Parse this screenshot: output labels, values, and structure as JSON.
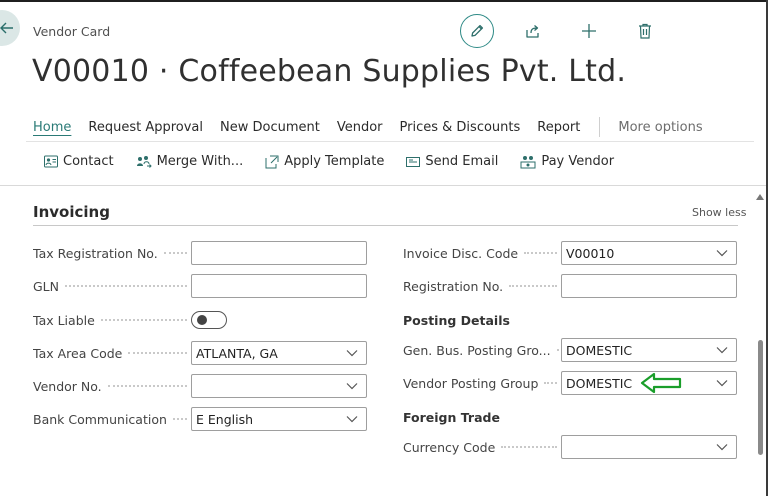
{
  "header": {
    "card_label": "Vendor Card",
    "title": "V00010 · Coffeebean Supplies Pvt. Ltd.",
    "actions": [
      {
        "name": "edit",
        "icon": "pencil-icon"
      },
      {
        "name": "share",
        "icon": "share-icon"
      },
      {
        "name": "new",
        "icon": "plus-icon"
      },
      {
        "name": "delete",
        "icon": "trash-icon"
      }
    ]
  },
  "menu": {
    "items": [
      "Home",
      "Request Approval",
      "New Document",
      "Vendor",
      "Prices & Discounts",
      "Report"
    ],
    "active": "Home",
    "more": "More options"
  },
  "toolbar": {
    "items": [
      "Contact",
      "Merge With...",
      "Apply Template",
      "Send Email",
      "Pay Vendor"
    ]
  },
  "section": {
    "title": "Invoicing",
    "toggle_label": "Show less"
  },
  "left_fields": [
    {
      "label": "Tax Registration No.",
      "value": "",
      "type": "text"
    },
    {
      "label": "GLN",
      "value": "",
      "type": "text"
    },
    {
      "label": "Tax Liable",
      "value": "off",
      "type": "toggle"
    },
    {
      "label": "Tax Area Code",
      "value": "ATLANTA, GA",
      "type": "select"
    },
    {
      "label": "Vendor No.",
      "value": "",
      "type": "select"
    },
    {
      "label": "Bank Communication",
      "value": "E English",
      "type": "select"
    }
  ],
  "right_fields": {
    "invoice_disc_code": {
      "label": "Invoice Disc. Code",
      "value": "V00010",
      "type": "select"
    },
    "registration_no": {
      "label": "Registration No.",
      "value": "",
      "type": "text"
    },
    "posting_details_heading": "Posting Details",
    "gen_bus_posting_group": {
      "label": "Gen. Bus. Posting Gro...",
      "value": "DOMESTIC",
      "type": "select"
    },
    "vendor_posting_group": {
      "label": "Vendor Posting Group",
      "value": "DOMESTIC",
      "type": "select"
    },
    "foreign_trade_heading": "Foreign Trade",
    "currency_code": {
      "label": "Currency Code",
      "value": "",
      "type": "select"
    }
  },
  "colors": {
    "accent": "#2a7a76",
    "annotation_arrow": "#1a9e2a"
  }
}
